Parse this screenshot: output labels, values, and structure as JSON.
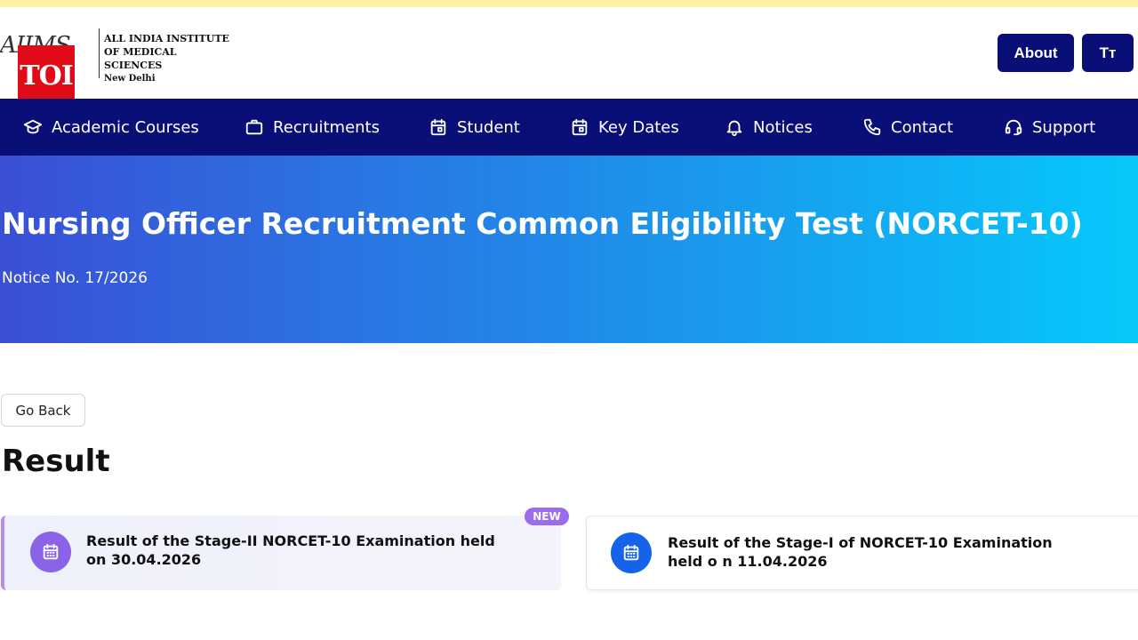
{
  "header": {
    "logo": {
      "script_text": "AIIMS",
      "line1": "ALL INDIA INSTITUTE",
      "line2": "OF MEDICAL SCIENCES",
      "line3": "New Delhi"
    },
    "watermark": "TOI",
    "about_label": "About",
    "font_size_label": "Tт"
  },
  "nav": {
    "items": [
      {
        "label": "Academic Courses",
        "icon": "graduation-cap-icon"
      },
      {
        "label": "Recruitments",
        "icon": "briefcase-icon"
      },
      {
        "label": "Student",
        "icon": "calendar-icon"
      },
      {
        "label": "Key Dates",
        "icon": "calendar-icon"
      },
      {
        "label": "Notices",
        "icon": "bell-icon"
      },
      {
        "label": "Contact",
        "icon": "phone-icon"
      },
      {
        "label": "Support",
        "icon": "headset-icon"
      }
    ]
  },
  "hero": {
    "title": "Nursing Officer Recruitment Common Eligibility Test (NORCET-10)",
    "notice": "Notice No. 17/2026"
  },
  "content": {
    "back_label": "Go Back",
    "section_title": "Result",
    "cards": [
      {
        "text": "Result of the Stage-II NORCET-10 Examination held on 30.04.2026",
        "badge": "NEW",
        "icon": "calendar-icon"
      },
      {
        "text": "Result of the Stage-I of NORCET-10 Examination held o n 11.04.2026",
        "icon": "calendar-icon"
      }
    ]
  },
  "colors": {
    "nav_bg": "#0a0f78",
    "hero_start": "#3a4fd6",
    "hero_end": "#06c8fb",
    "toi_red": "#e10a17",
    "badge_purple": "#9b6cf0"
  }
}
